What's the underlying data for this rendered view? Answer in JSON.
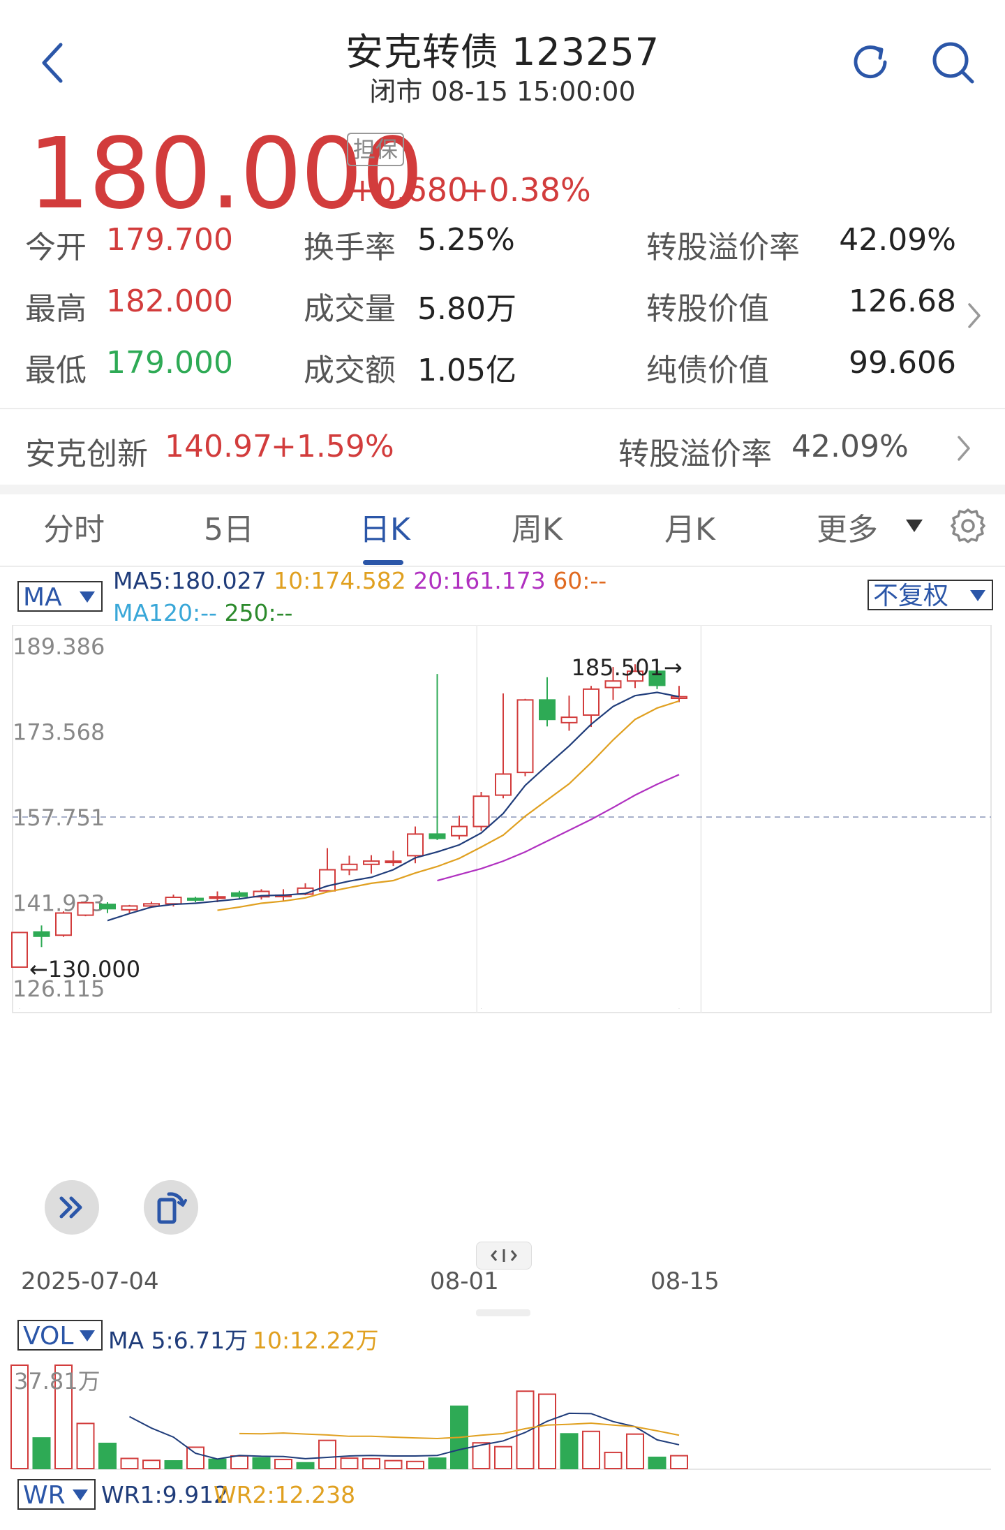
{
  "header": {
    "title": "安克转债 123257",
    "status": "闭市 08-15 15:00:00"
  },
  "quote": {
    "price": "180.000",
    "badge": "担保",
    "change": "+0.680",
    "change_pct": "+0.38%",
    "stats": [
      {
        "label": "今开",
        "value": "179.700",
        "tone": "red"
      },
      {
        "label": "换手率",
        "value": "5.25%",
        "tone": "dark"
      },
      {
        "label": "转股溢价率",
        "value": "42.09%",
        "tone": "dark"
      },
      {
        "label": "最高",
        "value": "182.000",
        "tone": "red"
      },
      {
        "label": "成交量",
        "value": "5.80万",
        "tone": "dark"
      },
      {
        "label": "转股价值",
        "value": "126.68",
        "tone": "dark"
      },
      {
        "label": "最低",
        "value": "179.000",
        "tone": "green"
      },
      {
        "label": "成交额",
        "value": "1.05亿",
        "tone": "dark"
      },
      {
        "label": "纯债价值",
        "value": "99.606",
        "tone": "dark"
      }
    ]
  },
  "underlying": {
    "name": "安克创新",
    "price": "140.97",
    "change_pct": "+1.59%",
    "premium_label": "转股溢价率",
    "premium_value": "42.09%"
  },
  "tabs": [
    "分时",
    "5日",
    "日K",
    "周K",
    "月K",
    "更多"
  ],
  "active_tab": "日K",
  "chart_controls": {
    "indicator": "MA",
    "adjust": "不复权",
    "ma_line1": [
      {
        "text": "MA5:180.027",
        "color": "#1f3c7a"
      },
      {
        "text": "10:174.582",
        "color": "#e0a020"
      },
      {
        "text": "20:161.173",
        "color": "#b030c0"
      },
      {
        "text": "60:--",
        "color": "#e06a20"
      }
    ],
    "ma_line2": [
      {
        "text": "MA120:--",
        "color": "#39a7d8"
      },
      {
        "text": "250:--",
        "color": "#2c8a2c"
      }
    ]
  },
  "chart_data": {
    "type": "candlestick",
    "y_ticks": [
      "189.386",
      "173.568",
      "157.751",
      "141.933",
      "126.115"
    ],
    "ylim": [
      126.115,
      189.386
    ],
    "x_labels": [
      "2025-07-04",
      "08-01",
      "08-15"
    ],
    "max_marker": "185.501→",
    "min_marker": "←130.000",
    "prev_close": 157.751,
    "candles": [
      {
        "o": 130.0,
        "c": 136.4,
        "h": 136.4,
        "l": 130.0
      },
      {
        "o": 136.5,
        "c": 135.7,
        "h": 137.7,
        "l": 133.7
      },
      {
        "o": 135.9,
        "c": 140.0,
        "h": 140.3,
        "l": 135.6
      },
      {
        "o": 139.6,
        "c": 141.9,
        "h": 142.0,
        "l": 139.4
      },
      {
        "o": 141.6,
        "c": 140.8,
        "h": 142.0,
        "l": 140.0
      },
      {
        "o": 140.6,
        "c": 141.3,
        "h": 141.5,
        "l": 140.0
      },
      {
        "o": 141.3,
        "c": 141.7,
        "h": 142.1,
        "l": 141.0
      },
      {
        "o": 141.7,
        "c": 142.9,
        "h": 143.4,
        "l": 141.2
      },
      {
        "o": 142.7,
        "c": 142.4,
        "h": 143.0,
        "l": 142.0
      },
      {
        "o": 143.0,
        "c": 143.0,
        "h": 144.0,
        "l": 142.0
      },
      {
        "o": 143.7,
        "c": 143.1,
        "h": 144.1,
        "l": 142.7
      },
      {
        "o": 143.0,
        "c": 144.0,
        "h": 144.4,
        "l": 142.5
      },
      {
        "o": 143.3,
        "c": 143.3,
        "h": 144.4,
        "l": 142.3
      },
      {
        "o": 143.5,
        "c": 144.6,
        "h": 145.5,
        "l": 143.3
      },
      {
        "o": 144.1,
        "c": 148.0,
        "h": 152.0,
        "l": 144.0
      },
      {
        "o": 148.0,
        "c": 149.0,
        "h": 150.6,
        "l": 147.0
      },
      {
        "o": 149.0,
        "c": 149.6,
        "h": 150.7,
        "l": 147.3
      },
      {
        "o": 149.6,
        "c": 149.6,
        "h": 151.5,
        "l": 148.7
      },
      {
        "o": 150.6,
        "c": 154.6,
        "h": 156.0,
        "l": 149.2
      },
      {
        "o": 154.6,
        "c": 153.8,
        "h": 184.2,
        "l": 153.5
      },
      {
        "o": 154.3,
        "c": 156.0,
        "h": 158.0,
        "l": 153.6
      },
      {
        "o": 156.0,
        "c": 161.6,
        "h": 162.4,
        "l": 155.2
      },
      {
        "o": 161.8,
        "c": 165.7,
        "h": 180.6,
        "l": 161.2
      },
      {
        "o": 166.0,
        "c": 179.4,
        "h": 179.6,
        "l": 165.3
      },
      {
        "o": 179.4,
        "c": 175.8,
        "h": 183.6,
        "l": 174.5
      },
      {
        "o": 175.2,
        "c": 176.2,
        "h": 180.2,
        "l": 173.7
      },
      {
        "o": 176.6,
        "c": 181.4,
        "h": 182.0,
        "l": 174.4
      },
      {
        "o": 181.7,
        "c": 182.9,
        "h": 185.5,
        "l": 179.4
      },
      {
        "o": 182.9,
        "c": 184.7,
        "h": 186.0,
        "l": 181.6
      },
      {
        "o": 184.7,
        "c": 182.1,
        "h": 186.9,
        "l": 181.4
      },
      {
        "o": 179.7,
        "c": 180.0,
        "h": 182.0,
        "l": 179.0
      }
    ],
    "ma5": [
      null,
      null,
      null,
      null,
      138.6,
      139.9,
      141.1,
      141.6,
      141.8,
      142.2,
      142.6,
      143.2,
      143.3,
      143.6,
      145.0,
      145.9,
      146.6,
      148.0,
      150.2,
      151.3,
      152.6,
      154.8,
      158.4,
      163.6,
      167.3,
      170.9,
      174.9,
      178.2,
      180.2,
      180.8,
      180.0
    ],
    "ma10": [
      null,
      null,
      null,
      null,
      null,
      null,
      null,
      null,
      null,
      140.5,
      141.1,
      141.8,
      142.2,
      142.8,
      143.9,
      144.7,
      145.5,
      146.0,
      147.4,
      148.6,
      150.1,
      152.2,
      154.4,
      157.9,
      160.9,
      163.9,
      167.8,
      172.0,
      175.8,
      177.9,
      179.2
    ],
    "ma20": [
      null,
      null,
      null,
      null,
      null,
      null,
      null,
      null,
      null,
      null,
      null,
      null,
      null,
      null,
      null,
      null,
      null,
      null,
      null,
      146.0,
      147.1,
      148.2,
      149.6,
      151.3,
      153.3,
      155.3,
      157.3,
      159.5,
      161.8,
      163.8,
      165.6
    ]
  },
  "volume": {
    "indicator": "VOL",
    "ma_text1": "MA 5:6.71万",
    "ma_text2": "10:12.22万",
    "axis_label": "37.81万",
    "bars": [
      37.81,
      11.2,
      37.81,
      16.5,
      9.2,
      3.7,
      3.0,
      2.8,
      7.8,
      3.4,
      4.6,
      3.9,
      3.3,
      2.1,
      10.3,
      3.8,
      3.6,
      2.9,
      2.6,
      3.8,
      22.8,
      9.4,
      8.0,
      28.3,
      27.2,
      12.7,
      13.6,
      5.9,
      12.6,
      4.1,
      4.7
    ],
    "bar_dirs": [
      "up",
      "down",
      "up",
      "up",
      "down",
      "up",
      "up",
      "down",
      "up",
      "down",
      "up",
      "down",
      "up",
      "down",
      "up",
      "up",
      "up",
      "up",
      "up",
      "down",
      "down",
      "up",
      "up",
      "up",
      "up",
      "down",
      "up",
      "up",
      "up",
      "down",
      "up"
    ],
    "ma5": [
      null,
      null,
      null,
      null,
      null,
      19.0,
      14.8,
      11.5,
      5.6,
      3.5,
      4.8,
      4.5,
      4.4,
      3.6,
      4.1,
      4.6,
      4.8,
      4.6,
      4.6,
      4.8,
      6.9,
      8.6,
      10.1,
      13.2,
      17.3,
      20.2,
      20.1,
      17.2,
      15.3,
      10.5,
      8.7
    ],
    "ma10": [
      null,
      null,
      null,
      null,
      null,
      null,
      null,
      null,
      null,
      null,
      12.8,
      12.7,
      13.0,
      12.6,
      12.3,
      11.8,
      11.8,
      11.5,
      11.2,
      11.0,
      11.4,
      12.2,
      12.8,
      14.6,
      15.9,
      16.2,
      16.6,
      15.9,
      15.3,
      13.8,
      12.2
    ]
  },
  "wr": {
    "indicator": "WR",
    "wr1": "WR1:9.912",
    "wr2": "WR2:12.238"
  },
  "colors": {
    "up": "#d23c3c",
    "down": "#2eaa55",
    "accent": "#2b56a8"
  }
}
